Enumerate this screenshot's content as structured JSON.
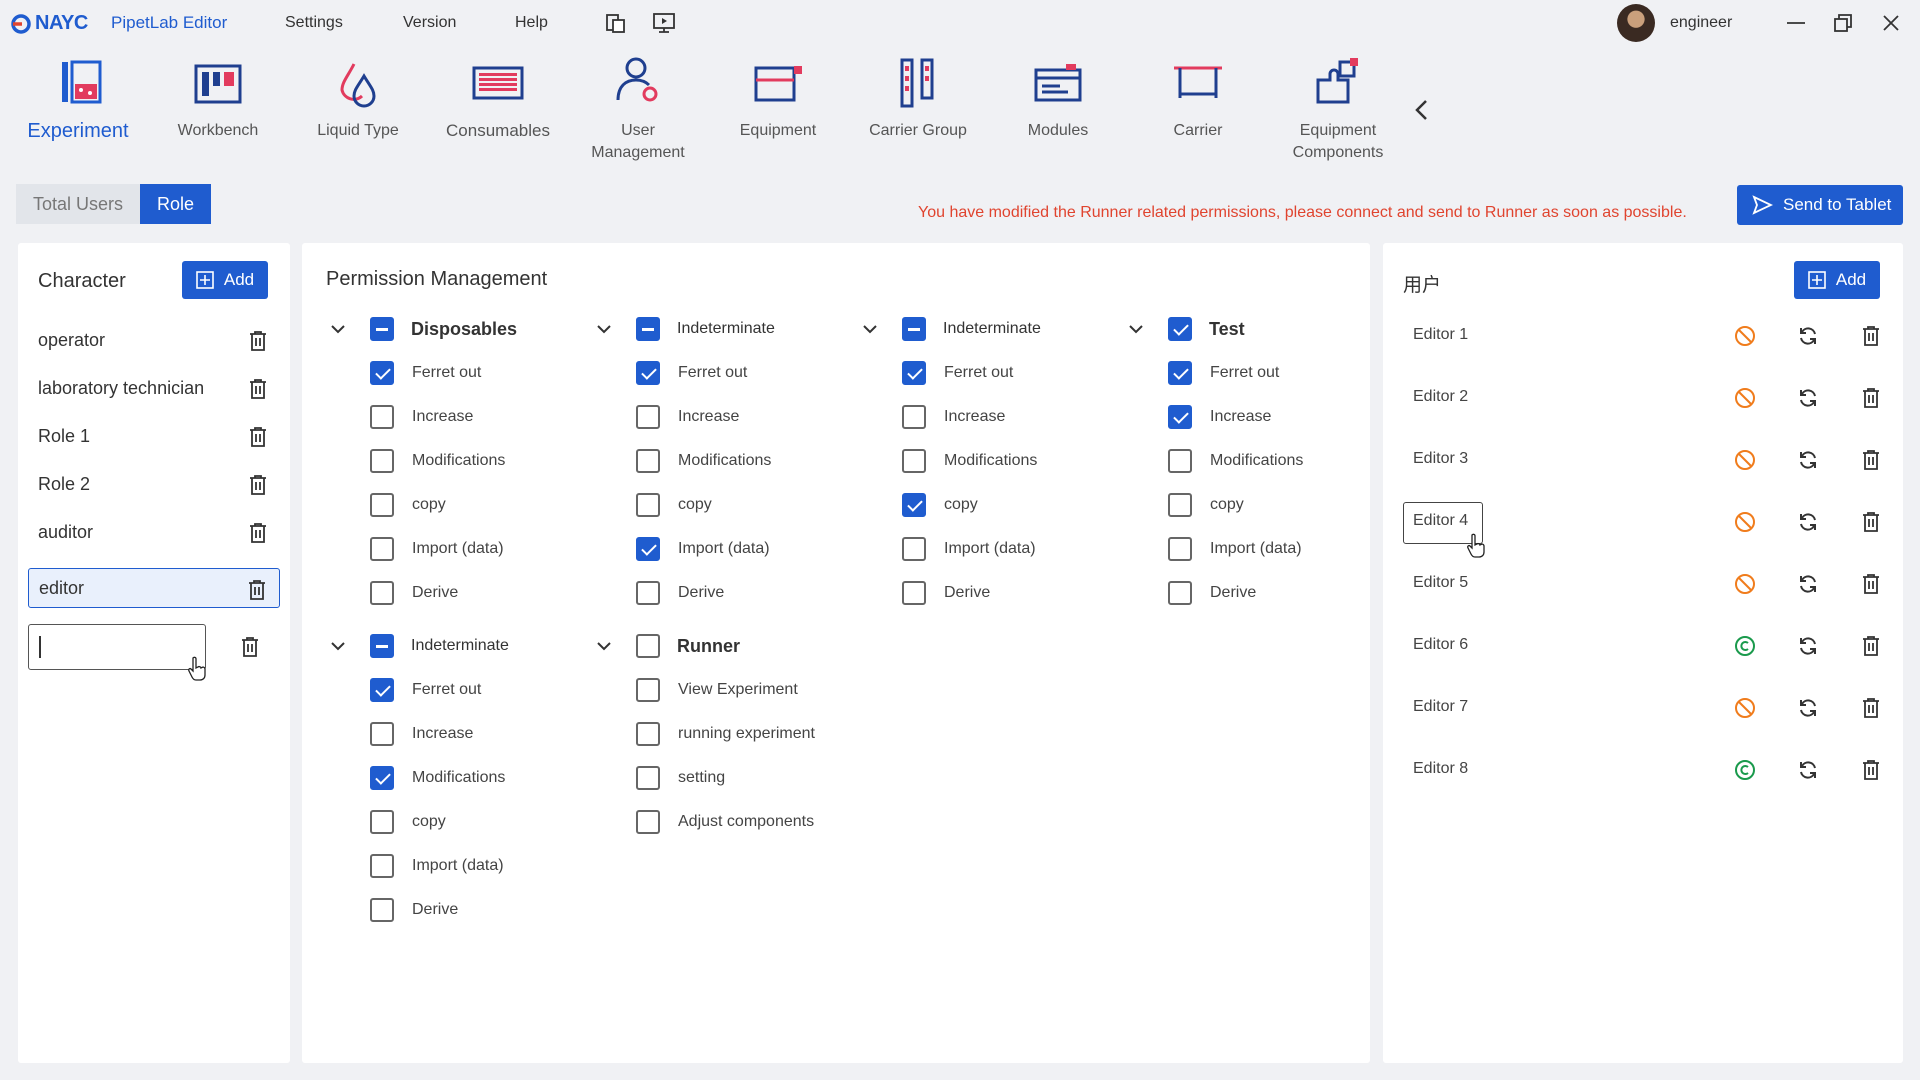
{
  "app": {
    "brand": "NAYC",
    "title": "PipetLab Editor",
    "menu": [
      "Settings",
      "Version",
      "Help"
    ],
    "user": "engineer"
  },
  "toolbar": {
    "items": [
      {
        "label": "Experiment",
        "active": true
      },
      {
        "label": "Workbench"
      },
      {
        "label": "Liquid Type"
      },
      {
        "label": "Consumables"
      },
      {
        "label": "User\nManagement"
      },
      {
        "label": "Equipment"
      },
      {
        "label": "Carrier Group"
      },
      {
        "label": "Modules"
      },
      {
        "label": "Carrier"
      },
      {
        "label": "Equipment\nComponents"
      }
    ]
  },
  "tabs": {
    "total_users": "Total Users",
    "role": "Role"
  },
  "warning": "You have modified the Runner related permissions, please connect and send to Runner as soon as possible.",
  "send_label": "Send to Tablet",
  "characters": {
    "title": "Character",
    "add_label": "Add",
    "roles": [
      "operator",
      "laboratory technician",
      "Role 1",
      "Role 2",
      "auditor",
      "editor"
    ],
    "selected": "editor",
    "new_role_value": ""
  },
  "permissions": {
    "title": "Permission Management",
    "groups": [
      {
        "label": "Disposables",
        "state": "indeterminate",
        "items": [
          {
            "label": "Ferret out",
            "checked": true
          },
          {
            "label": "Increase",
            "checked": false
          },
          {
            "label": "Modifications",
            "checked": false
          },
          {
            "label": "copy",
            "checked": false
          },
          {
            "label": "Import (data)",
            "checked": false
          },
          {
            "label": "Derive",
            "checked": false
          }
        ]
      },
      {
        "label": "Indeterminate",
        "state": "indeterminate",
        "items": [
          {
            "label": "Ferret out",
            "checked": true
          },
          {
            "label": "Increase",
            "checked": false
          },
          {
            "label": "Modifications",
            "checked": false
          },
          {
            "label": "copy",
            "checked": false
          },
          {
            "label": "Import (data)",
            "checked": true
          },
          {
            "label": "Derive",
            "checked": false
          }
        ]
      },
      {
        "label": "Indeterminate",
        "state": "indeterminate",
        "items": [
          {
            "label": "Ferret out",
            "checked": true
          },
          {
            "label": "Increase",
            "checked": false
          },
          {
            "label": "Modifications",
            "checked": false
          },
          {
            "label": "copy",
            "checked": true
          },
          {
            "label": "Import (data)",
            "checked": false
          },
          {
            "label": "Derive",
            "checked": false
          }
        ]
      },
      {
        "label": "Test",
        "state": "checked",
        "items": [
          {
            "label": "Ferret out",
            "checked": true
          },
          {
            "label": "Increase",
            "checked": true
          },
          {
            "label": "Modifications",
            "checked": false
          },
          {
            "label": "copy",
            "checked": false
          },
          {
            "label": "Import (data)",
            "checked": false
          },
          {
            "label": "Derive",
            "checked": false
          }
        ]
      },
      {
        "label": "Indeterminate",
        "state": "indeterminate",
        "items": [
          {
            "label": "Ferret out",
            "checked": true
          },
          {
            "label": "Increase",
            "checked": false
          },
          {
            "label": "Modifications",
            "checked": true
          },
          {
            "label": "copy",
            "checked": false
          },
          {
            "label": "Import (data)",
            "checked": false
          },
          {
            "label": "Derive",
            "checked": false
          }
        ]
      },
      {
        "label": "Runner",
        "state": "unchecked",
        "items": [
          {
            "label": "View Experiment",
            "checked": false
          },
          {
            "label": "running experiment",
            "checked": false
          },
          {
            "label": "setting",
            "checked": false
          },
          {
            "label": "Adjust components",
            "checked": false
          }
        ]
      }
    ]
  },
  "users": {
    "title": "用户",
    "add_label": "Add",
    "list": [
      {
        "name": "Editor 1",
        "status": "disabled"
      },
      {
        "name": "Editor 2",
        "status": "disabled"
      },
      {
        "name": "Editor 3",
        "status": "disabled"
      },
      {
        "name": "Editor 4",
        "status": "disabled"
      },
      {
        "name": "Editor 5",
        "status": "disabled"
      },
      {
        "name": "Editor 6",
        "status": "enabled"
      },
      {
        "name": "Editor 7",
        "status": "disabled"
      },
      {
        "name": "Editor 8",
        "status": "enabled"
      }
    ]
  },
  "colors": {
    "accent": "#1f5ccf",
    "warning": "#e0442f",
    "disabled_icon": "#f07c1c",
    "enabled_icon": "#1a9a4c"
  }
}
